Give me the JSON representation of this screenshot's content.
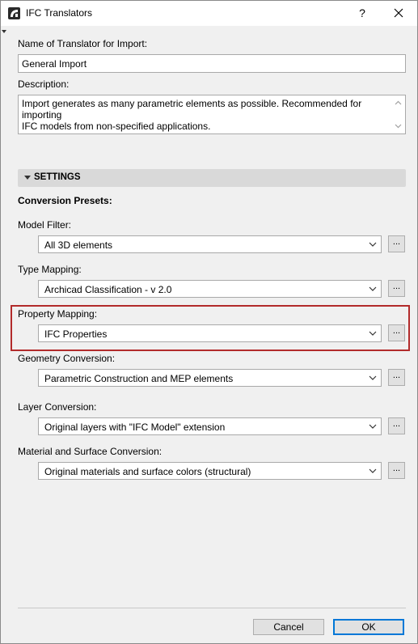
{
  "window": {
    "title": "IFC Translators",
    "help_label": "?"
  },
  "name_field": {
    "label": "Name of Translator for Import:",
    "value": "General Import"
  },
  "description": {
    "label": "Description:",
    "line1": "Import generates as many parametric elements as possible. Recommended for importing",
    "line2": "IFC models from non-specified applications."
  },
  "settings": {
    "header": "SETTINGS",
    "presets_label": "Conversion Presets:",
    "rows": [
      {
        "label": "Model Filter:",
        "value": "All 3D elements"
      },
      {
        "label": "Type Mapping:",
        "value": "Archicad Classification - v 2.0"
      },
      {
        "label": "Property Mapping:",
        "value": "IFC Properties"
      },
      {
        "label": "Geometry Conversion:",
        "value": "Parametric Construction and MEP elements"
      },
      {
        "label": "Layer Conversion:",
        "value": "Original layers with \"IFC Model\" extension"
      },
      {
        "label": "Material and Surface Conversion:",
        "value": "Original materials and surface colors (structural)"
      }
    ],
    "more_label": "..."
  },
  "buttons": {
    "cancel": "Cancel",
    "ok": "OK"
  },
  "colors": {
    "highlight": "#b22b2b",
    "ok_border": "#0078d7",
    "section_bg": "#d9d9d9"
  }
}
